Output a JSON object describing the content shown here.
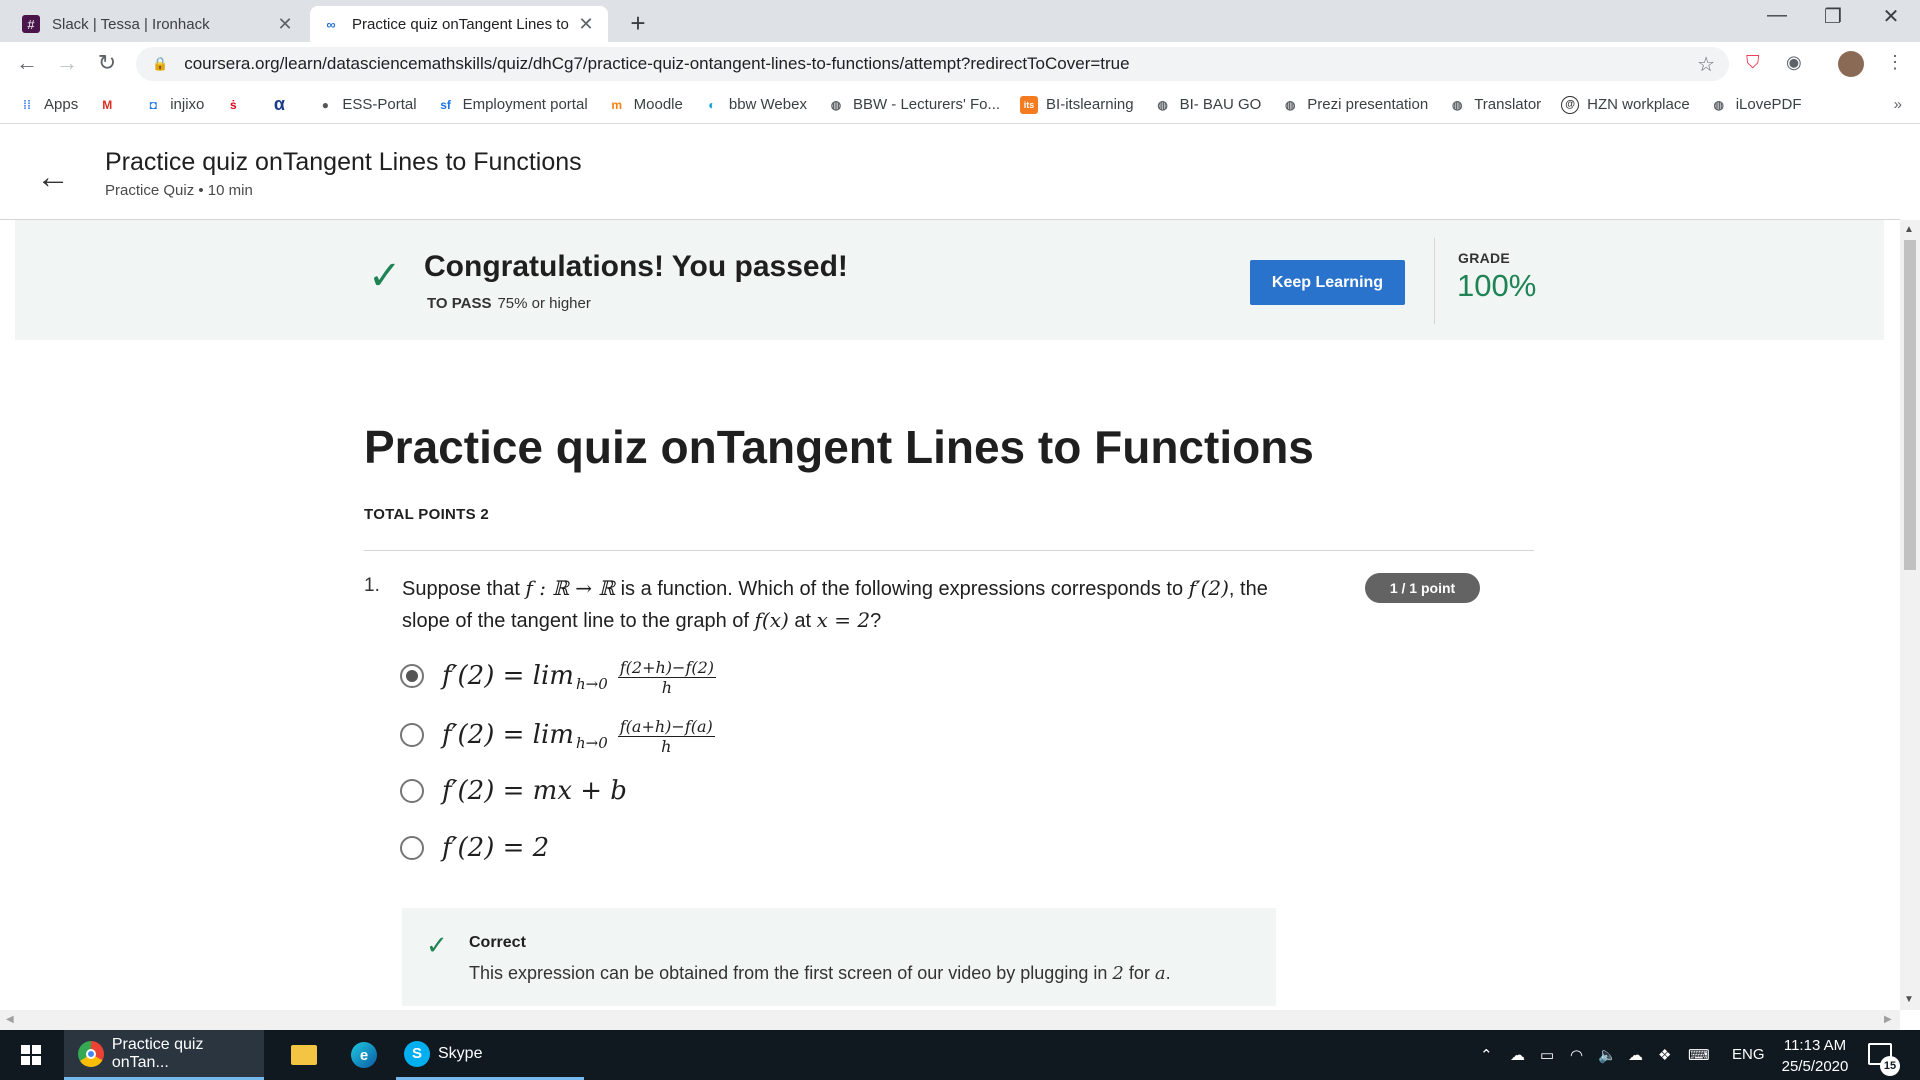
{
  "browser": {
    "tabs": [
      {
        "title": "Slack | Tessa | Ironhack",
        "active": false,
        "icon": "slack-icon"
      },
      {
        "title": "Practice quiz onTangent Lines to",
        "active": true,
        "icon": "coursera-icon"
      }
    ],
    "url": "coursera.org/learn/datasciencemathskills/quiz/dhCg7/practice-quiz-ontangent-lines-to-functions/attempt?redirectToCover=true",
    "bookmarks": [
      {
        "label": "Apps",
        "icon": "apps-grid-icon"
      },
      {
        "label": "",
        "icon": "gmail-icon"
      },
      {
        "label": "injixo",
        "icon": "injixo-icon"
      },
      {
        "label": "",
        "icon": "sparkasse-icon"
      },
      {
        "label": "",
        "icon": "alpha-icon"
      },
      {
        "label": "ESS-Portal",
        "icon": "apple-icon"
      },
      {
        "label": "Employment portal",
        "icon": "sf-icon"
      },
      {
        "label": "Moodle",
        "icon": "moodle-icon"
      },
      {
        "label": "bbw Webex",
        "icon": "webex-icon"
      },
      {
        "label": "BBW - Lecturers' Fo...",
        "icon": "globe-icon"
      },
      {
        "label": "BI-itslearning",
        "icon": "itslearning-icon"
      },
      {
        "label": "BI- BAU GO",
        "icon": "globe-icon"
      },
      {
        "label": "Prezi presentation",
        "icon": "globe-icon"
      },
      {
        "label": "Translator",
        "icon": "globe-icon"
      },
      {
        "label": "HZN workplace",
        "icon": "hzn-icon"
      },
      {
        "label": "iLovePDF",
        "icon": "globe-icon"
      }
    ],
    "bookmarks_more": "»"
  },
  "header": {
    "title": "Practice quiz onTangent Lines to Functions",
    "subtitle": "Practice Quiz • 10 min"
  },
  "banner": {
    "message": "Congratulations! You passed!",
    "to_pass_label": "TO PASS",
    "to_pass_value": "75% or higher",
    "button_label": "Keep Learning",
    "grade_label": "GRADE",
    "grade_value": "100%",
    "accent_color": "#1f8354",
    "button_color": "#2a73cc"
  },
  "quiz": {
    "title": "Practice quiz onTangent Lines to Functions",
    "total_points": "TOTAL POINTS 2",
    "question": {
      "number": "1.",
      "text_parts": [
        "Suppose that ",
        "f : ℝ → ℝ",
        " is a function. Which of the following expressions corresponds to ",
        "f′(2)",
        ", the slope of the tangent line to the graph of ",
        "f(x)",
        " at ",
        "x = 2",
        "?"
      ],
      "points": "1 / 1 point",
      "options": [
        {
          "lhs": "f′(2) = lim",
          "sub": "h→0",
          "num": "f(2+h)−f(2)",
          "den": "h",
          "selected": true
        },
        {
          "lhs": "f′(2) = lim",
          "sub": "h→0",
          "num": "f(a+h)−f(a)",
          "den": "h",
          "selected": false
        },
        {
          "lhs": "f′(2) = mx + b",
          "selected": false
        },
        {
          "lhs": "f′(2) = 2",
          "selected": false
        }
      ],
      "feedback": {
        "title": "Correct",
        "text_parts": [
          "This expression can be obtained from the first screen of our video by plugging in ",
          "2",
          " for ",
          "a",
          "."
        ]
      }
    }
  },
  "taskbar": {
    "items": [
      {
        "label": "Practice quiz onTan...",
        "icon": "chrome-icon",
        "active": true
      },
      {
        "label": "",
        "icon": "file-explorer-icon",
        "active": false
      },
      {
        "label": "",
        "icon": "edge-icon",
        "active": false
      },
      {
        "label": "Skype",
        "icon": "skype-icon",
        "active": false
      }
    ],
    "language": "ENG",
    "time": "11:13 AM",
    "date": "25/5/2020",
    "notifications": "15"
  }
}
